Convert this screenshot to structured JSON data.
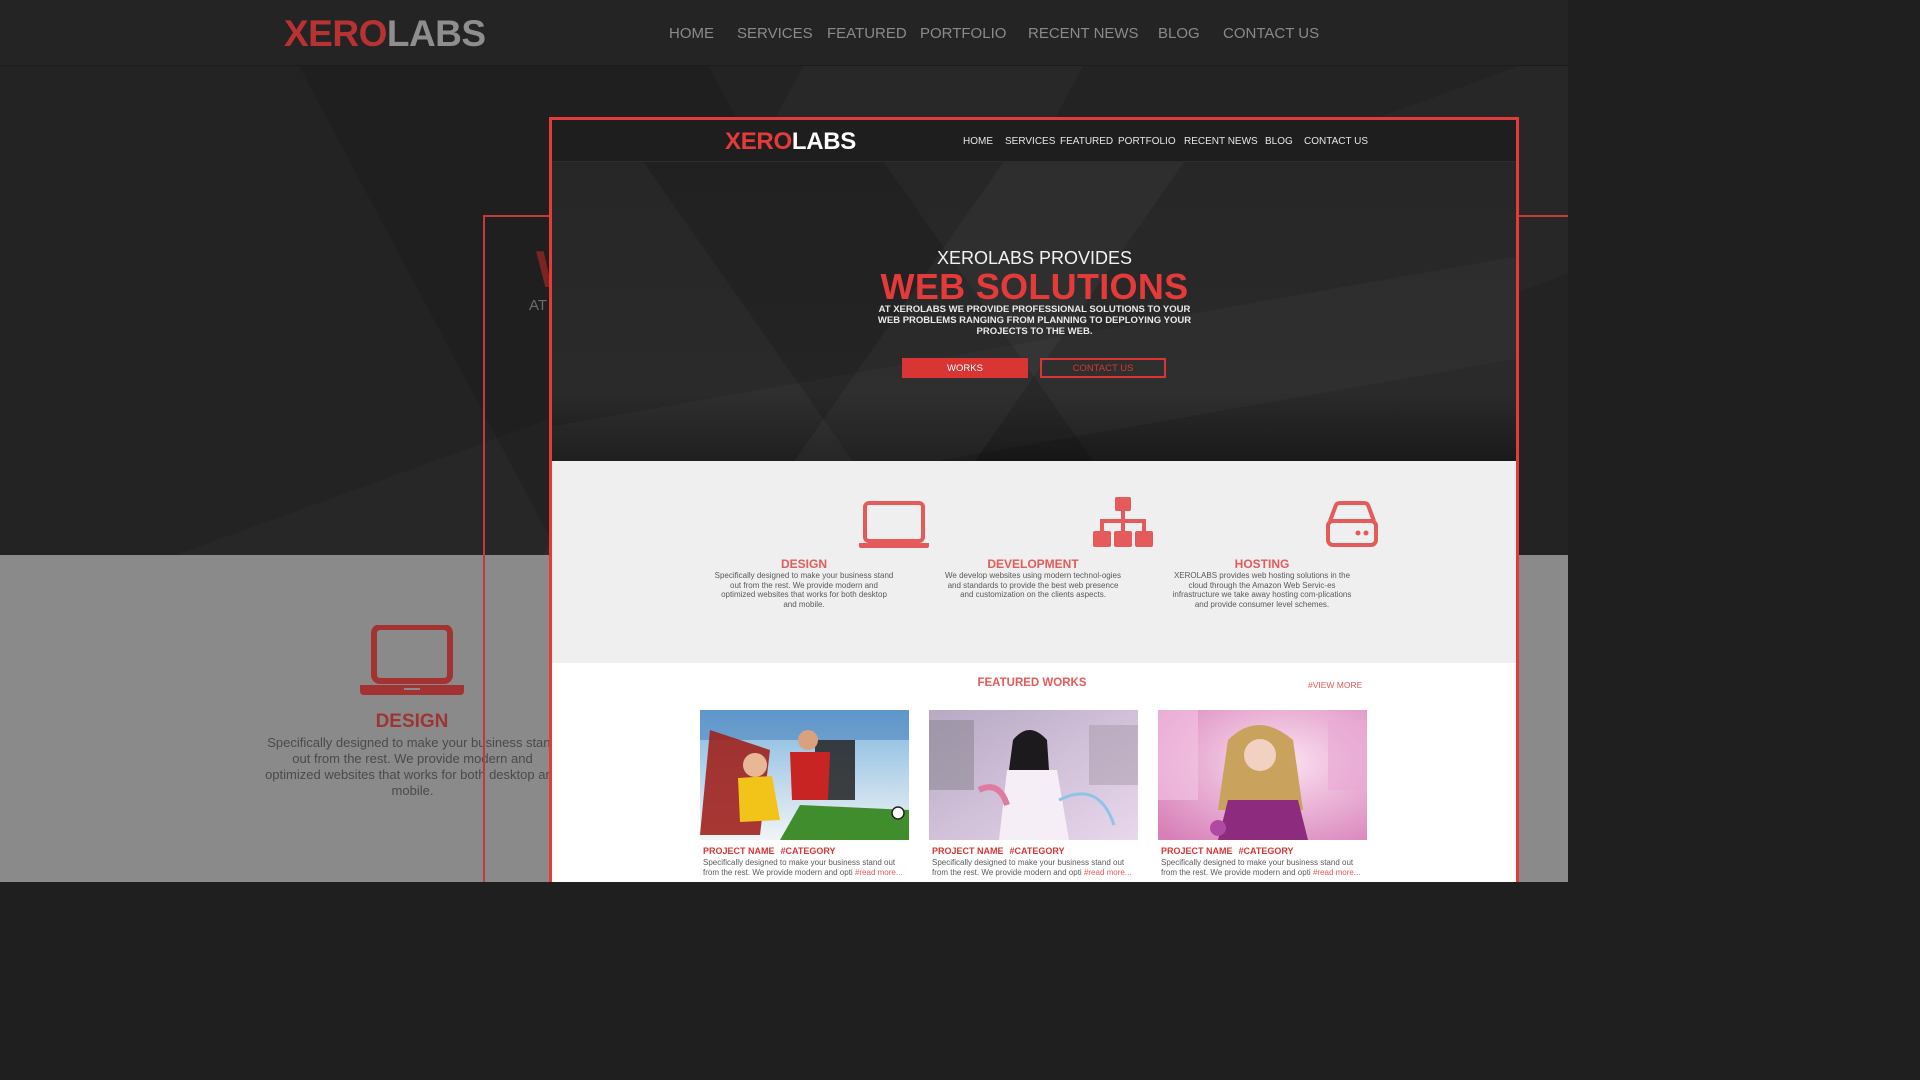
{
  "brand": {
    "xero": "XERO",
    "labs": "LABS"
  },
  "nav": [
    "HOME",
    "SERVICES",
    "FEATURED",
    "PORTFOLIO",
    "RECENT NEWS",
    "BLOG",
    "CONTACT US"
  ],
  "background_page": {
    "hero_letter": "W",
    "hero_sub_fragment": "AT",
    "design_title": "DESIGN",
    "design_desc": "Specifically designed to make your business stand out from the rest. We provide modern and optimized websites that works for both desktop and mobile."
  },
  "hero": {
    "provides": "XEROLABS PROVIDES",
    "headline": "WEB SOLUTIONS",
    "subtext": "AT XEROLABS WE PROVIDE PROFESSIONAL SOLUTIONS TO YOUR WEB PROBLEMS RANGING FROM PLANNING TO DEPLOYING YOUR PROJECTS TO THE WEB.",
    "btn_works": "WORKS",
    "btn_contact": "CONTACT US"
  },
  "services": [
    {
      "icon": "laptop-icon",
      "title": "DESIGN",
      "desc": "Specifically designed to make your business stand out from the rest. We provide modern and optimized websites that works for both desktop and mobile."
    },
    {
      "icon": "sitemap-icon",
      "title": "DEVELOPMENT",
      "desc": "We develop websites using modern technol-ogies and standards to provide the best web presence and customization on the clients aspects."
    },
    {
      "icon": "server-icon",
      "title": "HOSTING",
      "desc": "XEROLABS provides web hosting solutions in the cloud through the Amazon Web Servic-es infrastructure we take away hosting com-plications and provide consumer level schemes."
    }
  ],
  "featured": {
    "title": "FEATURED WORKS",
    "view_more": "#VIEW MORE",
    "cards": [
      {
        "name": "PROJECT NAME",
        "category": "#CATEGORY",
        "desc": "Specifically designed to make your business stand out from the rest. We provide modern and opti",
        "more": "#read more..."
      },
      {
        "name": "PROJECT NAME",
        "category": "#CATEGORY",
        "desc": "Specifically designed to make your business stand out from the rest. We provide modern and opti",
        "more": "#read more..."
      },
      {
        "name": "PROJECT NAME",
        "category": "#CATEGORY",
        "desc": "Specifically designed to make your business stand out from the rest. We provide modern and opti",
        "more": "#read more..."
      }
    ]
  },
  "colors": {
    "accent": "#e53a3a",
    "accent_soft": "#e55a5a",
    "dark": "#252525",
    "light_section": "#efefef"
  }
}
